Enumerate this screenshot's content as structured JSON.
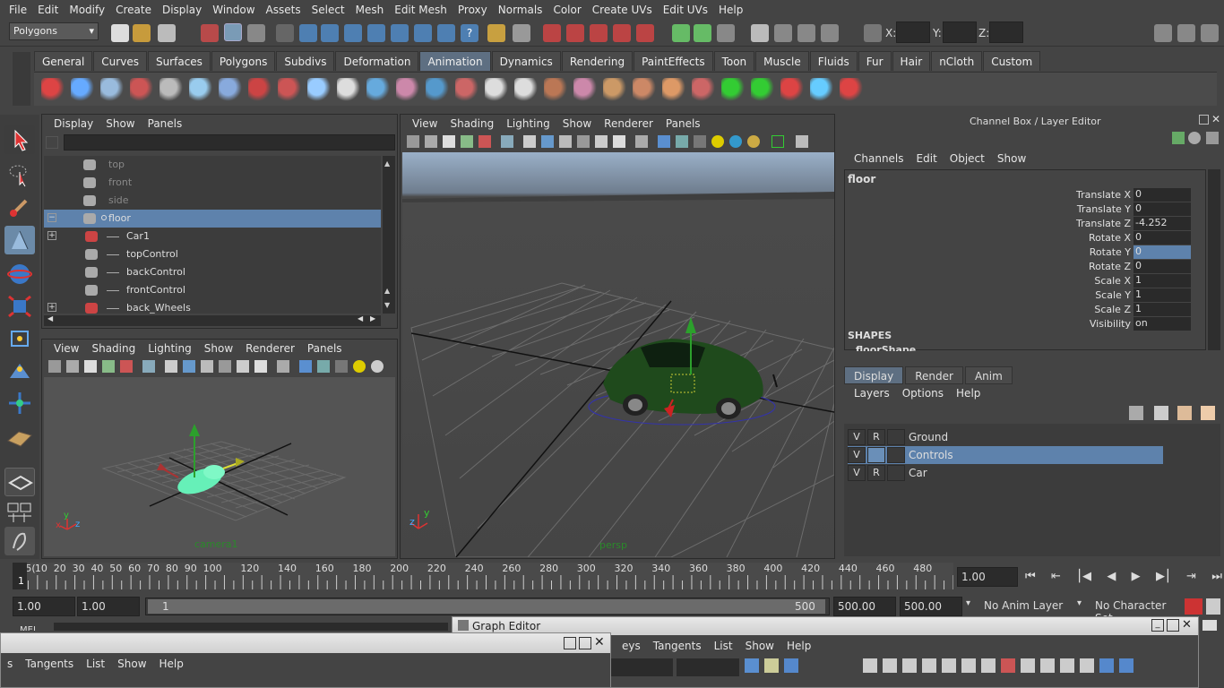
{
  "menubar": [
    "File",
    "Edit",
    "Modify",
    "Create",
    "Display",
    "Window",
    "Assets",
    "Select",
    "Mesh",
    "Edit Mesh",
    "Proxy",
    "Normals",
    "Color",
    "Create UVs",
    "Edit UVs",
    "Help"
  ],
  "status": {
    "mode": "Polygons",
    "x_label": "X:",
    "y_label": "Y:",
    "z_label": "Z:"
  },
  "shelf_tabs": [
    "General",
    "Curves",
    "Surfaces",
    "Polygons",
    "Subdivs",
    "Deformation",
    "Animation",
    "Dynamics",
    "Rendering",
    "PaintEffects",
    "Toon",
    "Muscle",
    "Fluids",
    "Fur",
    "Hair",
    "nCloth",
    "Custom"
  ],
  "shelf_active": "Animation",
  "outliner": {
    "menu": [
      "Display",
      "Show",
      "Panels"
    ],
    "items": [
      {
        "label": "top",
        "dim": true
      },
      {
        "label": "front",
        "dim": true
      },
      {
        "label": "side",
        "dim": true
      },
      {
        "label": "floor",
        "selected": true
      },
      {
        "label": "Car1"
      },
      {
        "label": "topControl"
      },
      {
        "label": "backControl"
      },
      {
        "label": "frontControl"
      },
      {
        "label": "back_Wheels"
      }
    ]
  },
  "cam_view": {
    "menu": [
      "View",
      "Shading",
      "Lighting",
      "Show",
      "Renderer",
      "Panels"
    ],
    "label": "camera1"
  },
  "persp_view": {
    "menu": [
      "View",
      "Shading",
      "Lighting",
      "Show",
      "Renderer",
      "Panels"
    ],
    "label": "persp"
  },
  "channel_box": {
    "title": "Channel Box / Layer Editor",
    "menu": [
      "Channels",
      "Edit",
      "Object",
      "Show"
    ],
    "object": "floor",
    "attrs": [
      {
        "label": "Translate X",
        "value": "0"
      },
      {
        "label": "Translate Y",
        "value": "0"
      },
      {
        "label": "Translate Z",
        "value": "-4.252"
      },
      {
        "label": "Rotate X",
        "value": "0"
      },
      {
        "label": "Rotate Y",
        "value": "0",
        "selected": true
      },
      {
        "label": "Rotate Z",
        "value": "0"
      },
      {
        "label": "Scale X",
        "value": "1"
      },
      {
        "label": "Scale Y",
        "value": "1"
      },
      {
        "label": "Scale Z",
        "value": "1"
      },
      {
        "label": "Visibility",
        "value": "on"
      }
    ],
    "shapes_header": "SHAPES",
    "shape": "floorShape"
  },
  "layer_editor": {
    "tabs": [
      "Display",
      "Render",
      "Anim"
    ],
    "active_tab": "Display",
    "menu": [
      "Layers",
      "Options",
      "Help"
    ],
    "layers": [
      {
        "v": "V",
        "r": "R",
        "name": "Ground"
      },
      {
        "v": "V",
        "r": "",
        "name": "Controls",
        "selected": true
      },
      {
        "v": "V",
        "r": "R",
        "name": "Car"
      }
    ]
  },
  "timeline": {
    "ticks": [
      "0",
      "10",
      "20",
      "30",
      "40",
      "50",
      "60",
      "70",
      "80",
      "90",
      "100",
      "120",
      "140",
      "160",
      "180",
      "200",
      "220",
      "240",
      "260",
      "280",
      "300",
      "320",
      "340",
      "360",
      "380",
      "400",
      "420",
      "440",
      "460",
      "480",
      "5("
    ],
    "current_frame_marker": "1",
    "current_time": "1.00"
  },
  "range": {
    "start": "1.00",
    "start2": "1.00",
    "slider_start": "1",
    "slider_end": "500",
    "end": "500.00",
    "end2": "500.00",
    "anim_layer": "No Anim Layer",
    "char_set": "No Character Set"
  },
  "graph_editor": {
    "title": "Graph Editor",
    "menu": [
      "Keys",
      "Tangents",
      "List",
      "Show",
      "Help"
    ],
    "menu_truncated_first": "eys"
  },
  "mel": "MEL",
  "second_window": {
    "menu": [
      "s",
      "Tangents",
      "List",
      "Show",
      "Help"
    ]
  }
}
